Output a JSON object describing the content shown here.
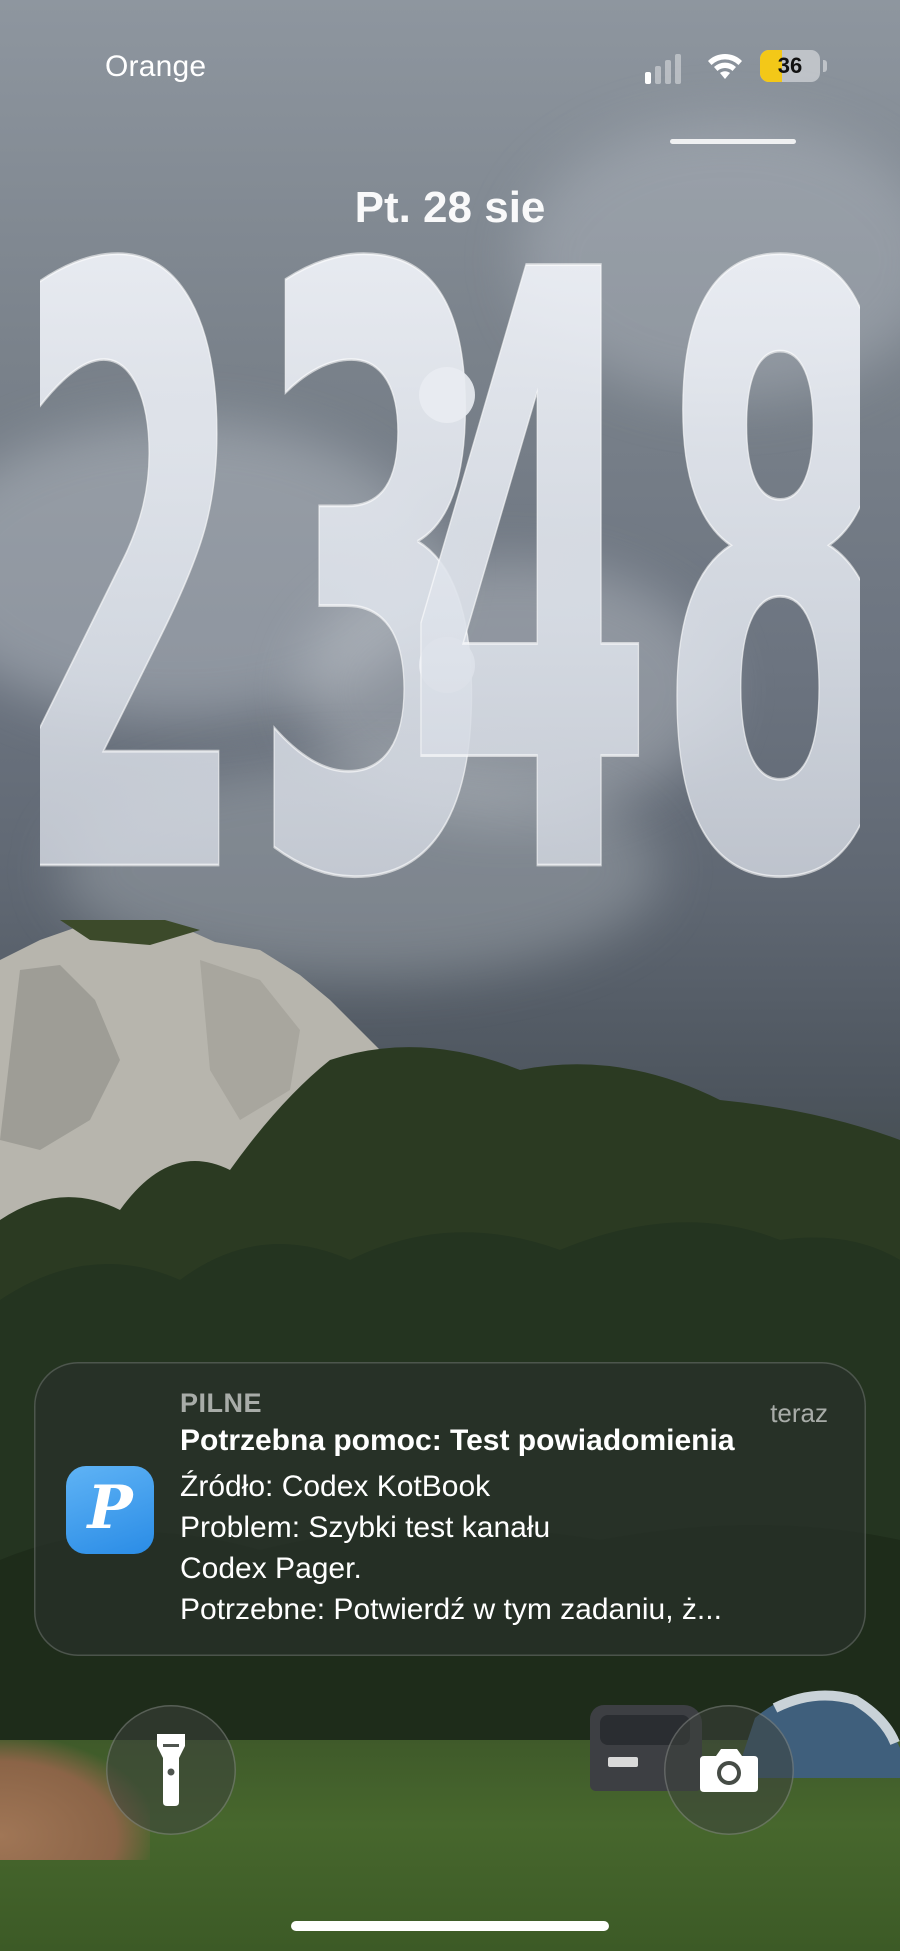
{
  "status_bar": {
    "carrier": "Orange",
    "signal_bars": 1,
    "wifi": "wifi-icon",
    "battery_percent": "36",
    "battery_level": 0.36,
    "battery_color": "#f3c818"
  },
  "lock_screen": {
    "date": "Pt. 28 sie",
    "time": "23:48",
    "time_hours": "23",
    "time_minutes": "48"
  },
  "notification": {
    "category": "PILNE",
    "timestamp": "teraz",
    "title": "Potrzebna pomoc: Test powiadomienia",
    "body_lines": [
      "Źródło: Codex KotBook",
      "Problem: Szybki test kanału",
      "Codex Pager.",
      "Potrzebne: Potwierdź w tym zadaniu, ż..."
    ],
    "app_icon_letter": "P",
    "app_icon_color": "#2a8ce6"
  },
  "quick_actions": {
    "left": "flashlight-icon",
    "right": "camera-icon"
  }
}
